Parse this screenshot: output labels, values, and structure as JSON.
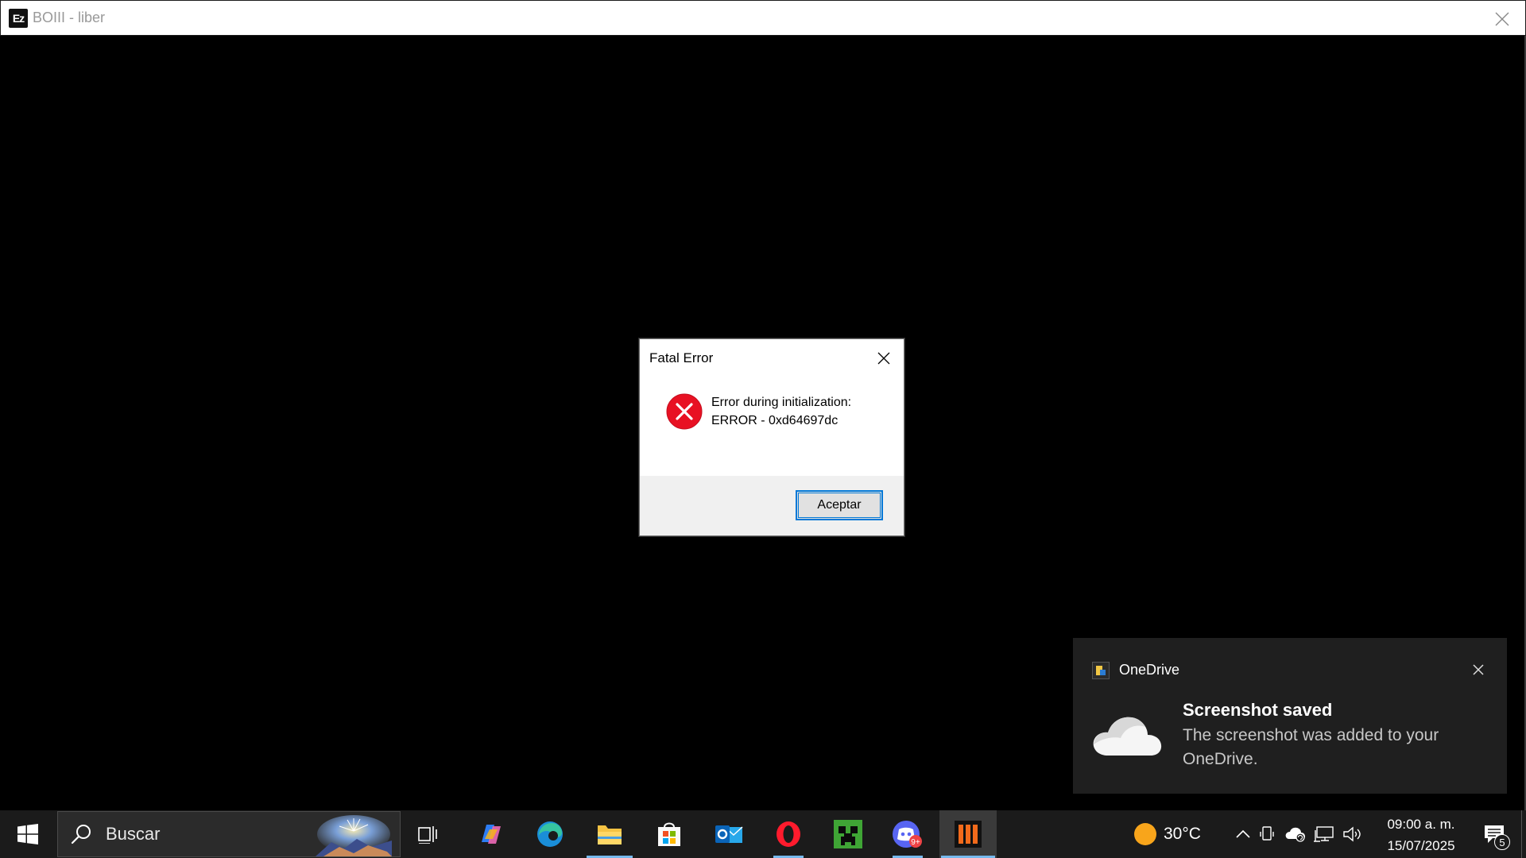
{
  "window": {
    "title": "BOIII - liber",
    "icon_text": "Ez"
  },
  "dialog": {
    "title": "Fatal Error",
    "message_line1": "Error during initialization:",
    "message_line2": "ERROR - 0xd64697dc",
    "ok_label": "Aceptar",
    "icon": "error-icon"
  },
  "toast": {
    "app_name": "OneDrive",
    "heading": "Screenshot saved",
    "body": "The screenshot was added to your OneDrive."
  },
  "taskbar": {
    "search_placeholder": "Buscar",
    "apps": [
      {
        "name": "task-view-icon"
      },
      {
        "name": "copilot-icon"
      },
      {
        "name": "edge-icon"
      },
      {
        "name": "file-explorer-icon"
      },
      {
        "name": "microsoft-store-icon"
      },
      {
        "name": "outlook-icon"
      },
      {
        "name": "opera-icon"
      },
      {
        "name": "minecraft-icon"
      },
      {
        "name": "discord-icon",
        "badge": "9+"
      },
      {
        "name": "boiii-icon"
      }
    ],
    "weather_temp": "30°C",
    "time": "09:00 a. m.",
    "date": "15/07/2025",
    "notification_count": "5"
  },
  "colors": {
    "accent": "#0078d7",
    "error": "#e81123",
    "taskbar_bg": "#1b1b1b",
    "toast_bg": "#1f1f1f"
  }
}
